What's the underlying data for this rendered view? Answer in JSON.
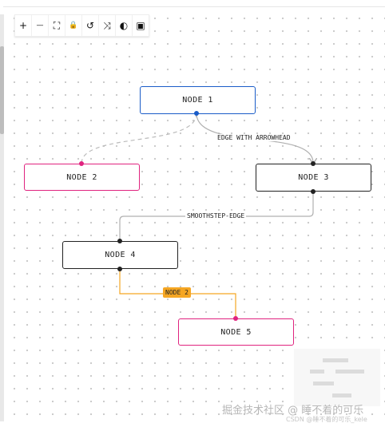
{
  "toolbar": {
    "zoom_in": "+",
    "zoom_out": "—",
    "fit_view": "⛶",
    "lock": "🔒",
    "undo": "↺",
    "shuffle": "⤨",
    "theme": "◐",
    "minimap": "▣"
  },
  "nodes": {
    "n1": "NODE 1",
    "n2": "NODE 2",
    "n3": "NODE 3",
    "n4": "NODE 4",
    "n5": "NODE 5"
  },
  "edges": {
    "e13": "EDGE WITH ARROWHEAD",
    "e34": "SMOOTHSTEP-EDGE",
    "e45": "NODE 2"
  },
  "colors": {
    "node1_border": "#1a5cc8",
    "pink": "#e0237f",
    "orange": "#f5a623",
    "dashed_edge": "#bbbbbb"
  },
  "watermark": {
    "main": "掘金技术社区 @ 睡不着的可乐",
    "sub": "CSDN @睡不着的可乐_kele"
  }
}
